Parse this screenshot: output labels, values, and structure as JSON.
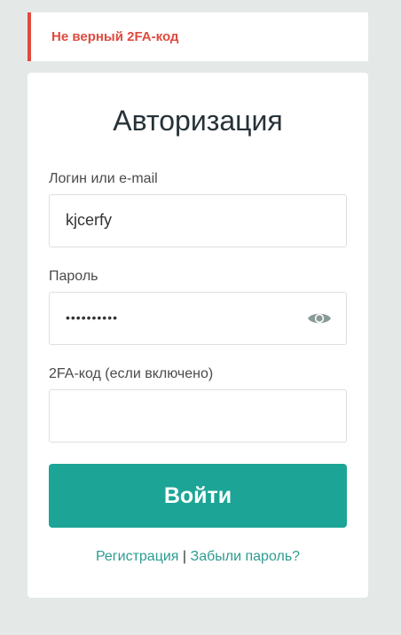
{
  "alert": {
    "message": "Не верный 2FA-код"
  },
  "form": {
    "title": "Авторизация",
    "login": {
      "label": "Логин или e-mail",
      "value": "kjcerfy"
    },
    "password": {
      "label": "Пароль",
      "masked_value": "••••••••••",
      "toggle_icon": "eye-icon"
    },
    "twofa": {
      "label": "2FA-код (если включено)",
      "value": ""
    },
    "submit_label": "Войти"
  },
  "links": {
    "register": "Регистрация",
    "separator": "|",
    "forgot": "Забыли пароль?"
  },
  "colors": {
    "accent": "#1ca596",
    "error": "#e04a3f",
    "link": "#2d9c90"
  }
}
